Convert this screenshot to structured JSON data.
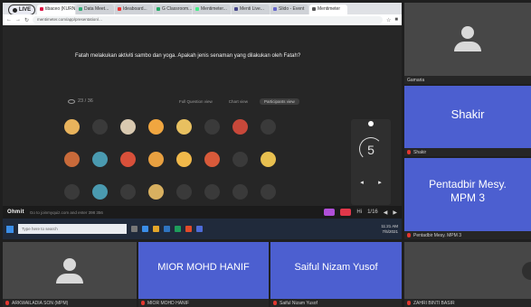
{
  "browser": {
    "live_badge": "LIVE",
    "tabs": [
      {
        "label": "tibaceo (KURNIA...",
        "active": true,
        "fav": "#d14"
      },
      {
        "label": "Data Meet...",
        "active": false,
        "fav": "#3a7"
      },
      {
        "label": "Ideaboard...",
        "active": false,
        "fav": "#e33"
      },
      {
        "label": "G Classroom...",
        "active": false,
        "fav": "#2a6"
      },
      {
        "label": "Mentimeter...",
        "active": false,
        "fav": "#4e8"
      },
      {
        "label": "Menti Live...",
        "active": false,
        "fav": "#448"
      },
      {
        "label": "Slido - Event",
        "active": false,
        "fav": "#66c"
      },
      {
        "label": "Mentimeter",
        "active": true,
        "fav": "#555"
      }
    ],
    "url": "mentimeter.com/app/presentation/..."
  },
  "slide": {
    "question": "Fatah melakukan aktiviti sambo dan yoga. Apakah jenis senaman yang dilakukan oleh Fatah?",
    "response_count": "23 / 36",
    "view_tabs": [
      "Full Question view",
      "Chart view",
      "Participants view"
    ],
    "timer_value": "5",
    "tooltip": "Countdown",
    "avatar_colors": [
      "#e8b35c",
      "#3a3a3a",
      "#d9c9b0",
      "#f0a640",
      "#e8c060",
      "#3a3a3a",
      "#c8483a",
      "#3a3a3a",
      "#c86a3a",
      "#4a9ab0",
      "#d8503a",
      "#e8a040",
      "#f0b84a",
      "#d85a3a",
      "#3a3a3a",
      "#e8c050",
      "#3a3a3a",
      "#4a9ab0",
      "#3a3a3a",
      "#d8b060",
      "#3a3a3a",
      "#3a3a3a",
      "#3a3a3a",
      "#3a3a3a"
    ]
  },
  "appbar": {
    "brand": "Ohmit",
    "join_text": "Go to joinmyquiz.com and enter 398 356",
    "controls": [
      "Hi",
      "1/16",
      "◀",
      "▶"
    ]
  },
  "taskbar": {
    "search_placeholder": "Type here to search",
    "clock": "11:21 AM",
    "date": "7/5/2021"
  },
  "participants": {
    "right_top": {
      "footer": "Gamaria"
    },
    "right_mid": {
      "big": "Shakir",
      "footer": "Shakir"
    },
    "right_low": {
      "big": "Pentadbir Mesy. MPM 3",
      "footer": "Pentadbir Mesy. MPM 3"
    },
    "bottom_1": {
      "footer": "ARKWAILADIA SON (MPM)"
    },
    "bottom_2": {
      "big": "MIOR MOHD HANIF",
      "footer": "MIOR MOHD HANIF"
    },
    "bottom_3": {
      "big": "Saiful Nizam Yusof",
      "footer": "Saiful Nizam Yusof"
    },
    "bottom_4": {
      "footer": "ZAHRI BINTI BASIR"
    }
  },
  "colors": {
    "tile_blue": "#4c5fd0",
    "tile_gray": "#474747",
    "muted_mic": "#e2372f"
  }
}
